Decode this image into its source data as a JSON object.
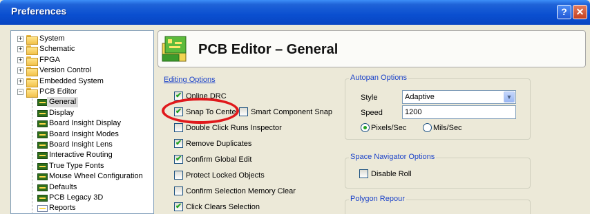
{
  "window": {
    "title": "Preferences",
    "help_button": "?",
    "close_button": "✕"
  },
  "tree": {
    "items": [
      {
        "label": "System",
        "type": "folder",
        "expander": "+"
      },
      {
        "label": "Schematic",
        "type": "folder",
        "expander": "+"
      },
      {
        "label": "FPGA",
        "type": "folder",
        "expander": "+"
      },
      {
        "label": "Version Control",
        "type": "folder",
        "expander": "+"
      },
      {
        "label": "Embedded System",
        "type": "folder",
        "expander": "+"
      },
      {
        "label": "PCB Editor",
        "type": "folder-open",
        "expander": "−"
      },
      {
        "label": "General",
        "type": "board",
        "selected": true
      },
      {
        "label": "Display",
        "type": "board"
      },
      {
        "label": "Board Insight Display",
        "type": "board"
      },
      {
        "label": "Board Insight Modes",
        "type": "board"
      },
      {
        "label": "Board Insight Lens",
        "type": "board"
      },
      {
        "label": "Interactive Routing",
        "type": "board"
      },
      {
        "label": "True Type Fonts",
        "type": "board"
      },
      {
        "label": "Mouse Wheel Configuration",
        "type": "board"
      },
      {
        "label": "Defaults",
        "type": "board"
      },
      {
        "label": "PCB Legacy 3D",
        "type": "board3d"
      },
      {
        "label": "Reports",
        "type": "doc"
      }
    ]
  },
  "header": {
    "title": "PCB Editor – General"
  },
  "editing_options": {
    "label": "Editing Options",
    "items": [
      {
        "label": "Online DRC",
        "checked": true
      },
      {
        "label": "Snap To Center",
        "checked": true
      },
      {
        "label": "Smart Component Snap",
        "checked": false
      },
      {
        "label": "Double Click Runs Inspector",
        "checked": false
      },
      {
        "label": "Remove Duplicates",
        "checked": true
      },
      {
        "label": "Confirm Global Edit",
        "checked": true
      },
      {
        "label": "Protect Locked Objects",
        "checked": false
      },
      {
        "label": "Confirm Selection Memory Clear",
        "checked": false
      },
      {
        "label": "Click Clears Selection",
        "checked": true
      }
    ]
  },
  "autopan": {
    "label": "Autopan Options",
    "style_label": "Style",
    "style_value": "Adaptive",
    "speed_label": "Speed",
    "speed_value": "1200",
    "unit_pixels": "Pixels/Sec",
    "unit_mils": "Mils/Sec",
    "selected_unit": "Pixels/Sec"
  },
  "space_navigator": {
    "label": "Space Navigator Options",
    "disable_roll_label": "Disable Roll",
    "disable_roll_checked": false
  },
  "polygon_repour": {
    "label": "Polygon Repour"
  },
  "colors": {
    "titlebar": "#0a4fd0",
    "accent_label": "#1c43c9",
    "highlight_ellipse": "#e0191c"
  }
}
